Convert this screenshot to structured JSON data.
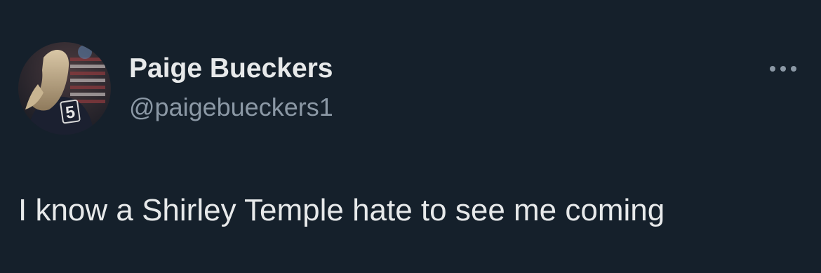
{
  "tweet": {
    "author": {
      "display_name": "Paige Bueckers",
      "handle": "@paigebueckers1",
      "avatar_icon": "profile-photo",
      "jersey_number": "5"
    },
    "text": "I know a Shirley Temple hate to see me coming",
    "more_icon": "more-horizontal-icon"
  },
  "colors": {
    "background": "#15202b",
    "primary_text": "#e7e9ea",
    "secondary_text": "#8b98a5"
  }
}
